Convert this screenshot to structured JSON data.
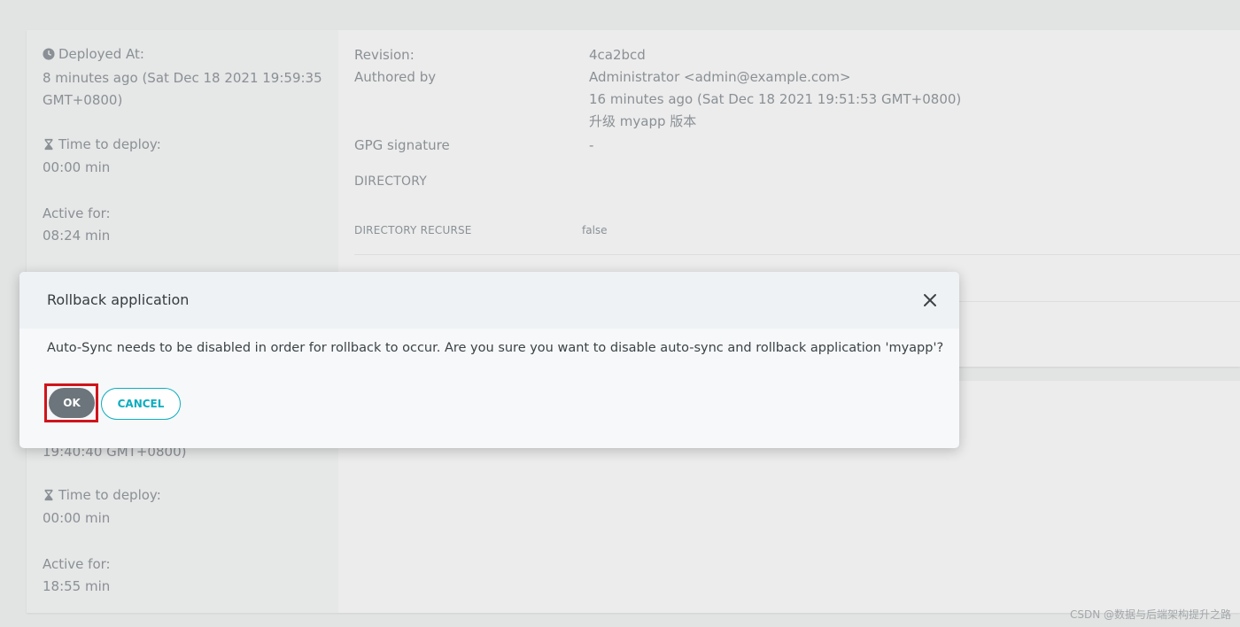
{
  "top_card": {
    "deployed_at_label": "Deployed At:",
    "deployed_at_line1": "8 minutes ago (Sat Dec 18 2021 19:59:35",
    "deployed_at_line2": "GMT+0800)",
    "time_to_deploy_label": "Time to deploy:",
    "time_to_deploy_value": "00:00 min",
    "active_for_label": "Active for:",
    "active_for_value": "08:24 min",
    "revision_label": "Revision:",
    "revision_value": "4ca2bcd",
    "authored_by_label": "Authored by",
    "author": "Administrator <admin@example.com>",
    "authored_time": "16 minutes ago (Sat Dec 18 2021 19:51:53 GMT+0800)",
    "commit_message": "升级 myapp 版本",
    "gpg_label": "GPG signature",
    "gpg_value": "-",
    "directory_label": "DIRECTORY",
    "directory_recurse_label": "DIRECTORY RECURSE",
    "directory_recurse_value": "false"
  },
  "bottom_card": {
    "deployed_at_partial": "19:40:40 GMT+0800)",
    "time_to_deploy_label": "Time to deploy:",
    "time_to_deploy_value": "00:00 min",
    "active_for_label": "Active for:",
    "active_for_value": "18:55 min"
  },
  "modal": {
    "title": "Rollback application",
    "message": "Auto-Sync needs to be disabled in order for rollback to occur. Are you sure you want to disable auto-sync and rollback application 'myapp'?",
    "ok_label": "OK",
    "cancel_label": "CANCEL"
  },
  "icons": {
    "clock": "clock-icon",
    "hourglass": "hourglass-icon",
    "close": "close-icon"
  },
  "colors": {
    "accent": "#0dadbf",
    "ok_button": "#6c757b",
    "highlight": "#d0141c"
  },
  "watermark": "CSDN @数据与后端架构提升之路"
}
